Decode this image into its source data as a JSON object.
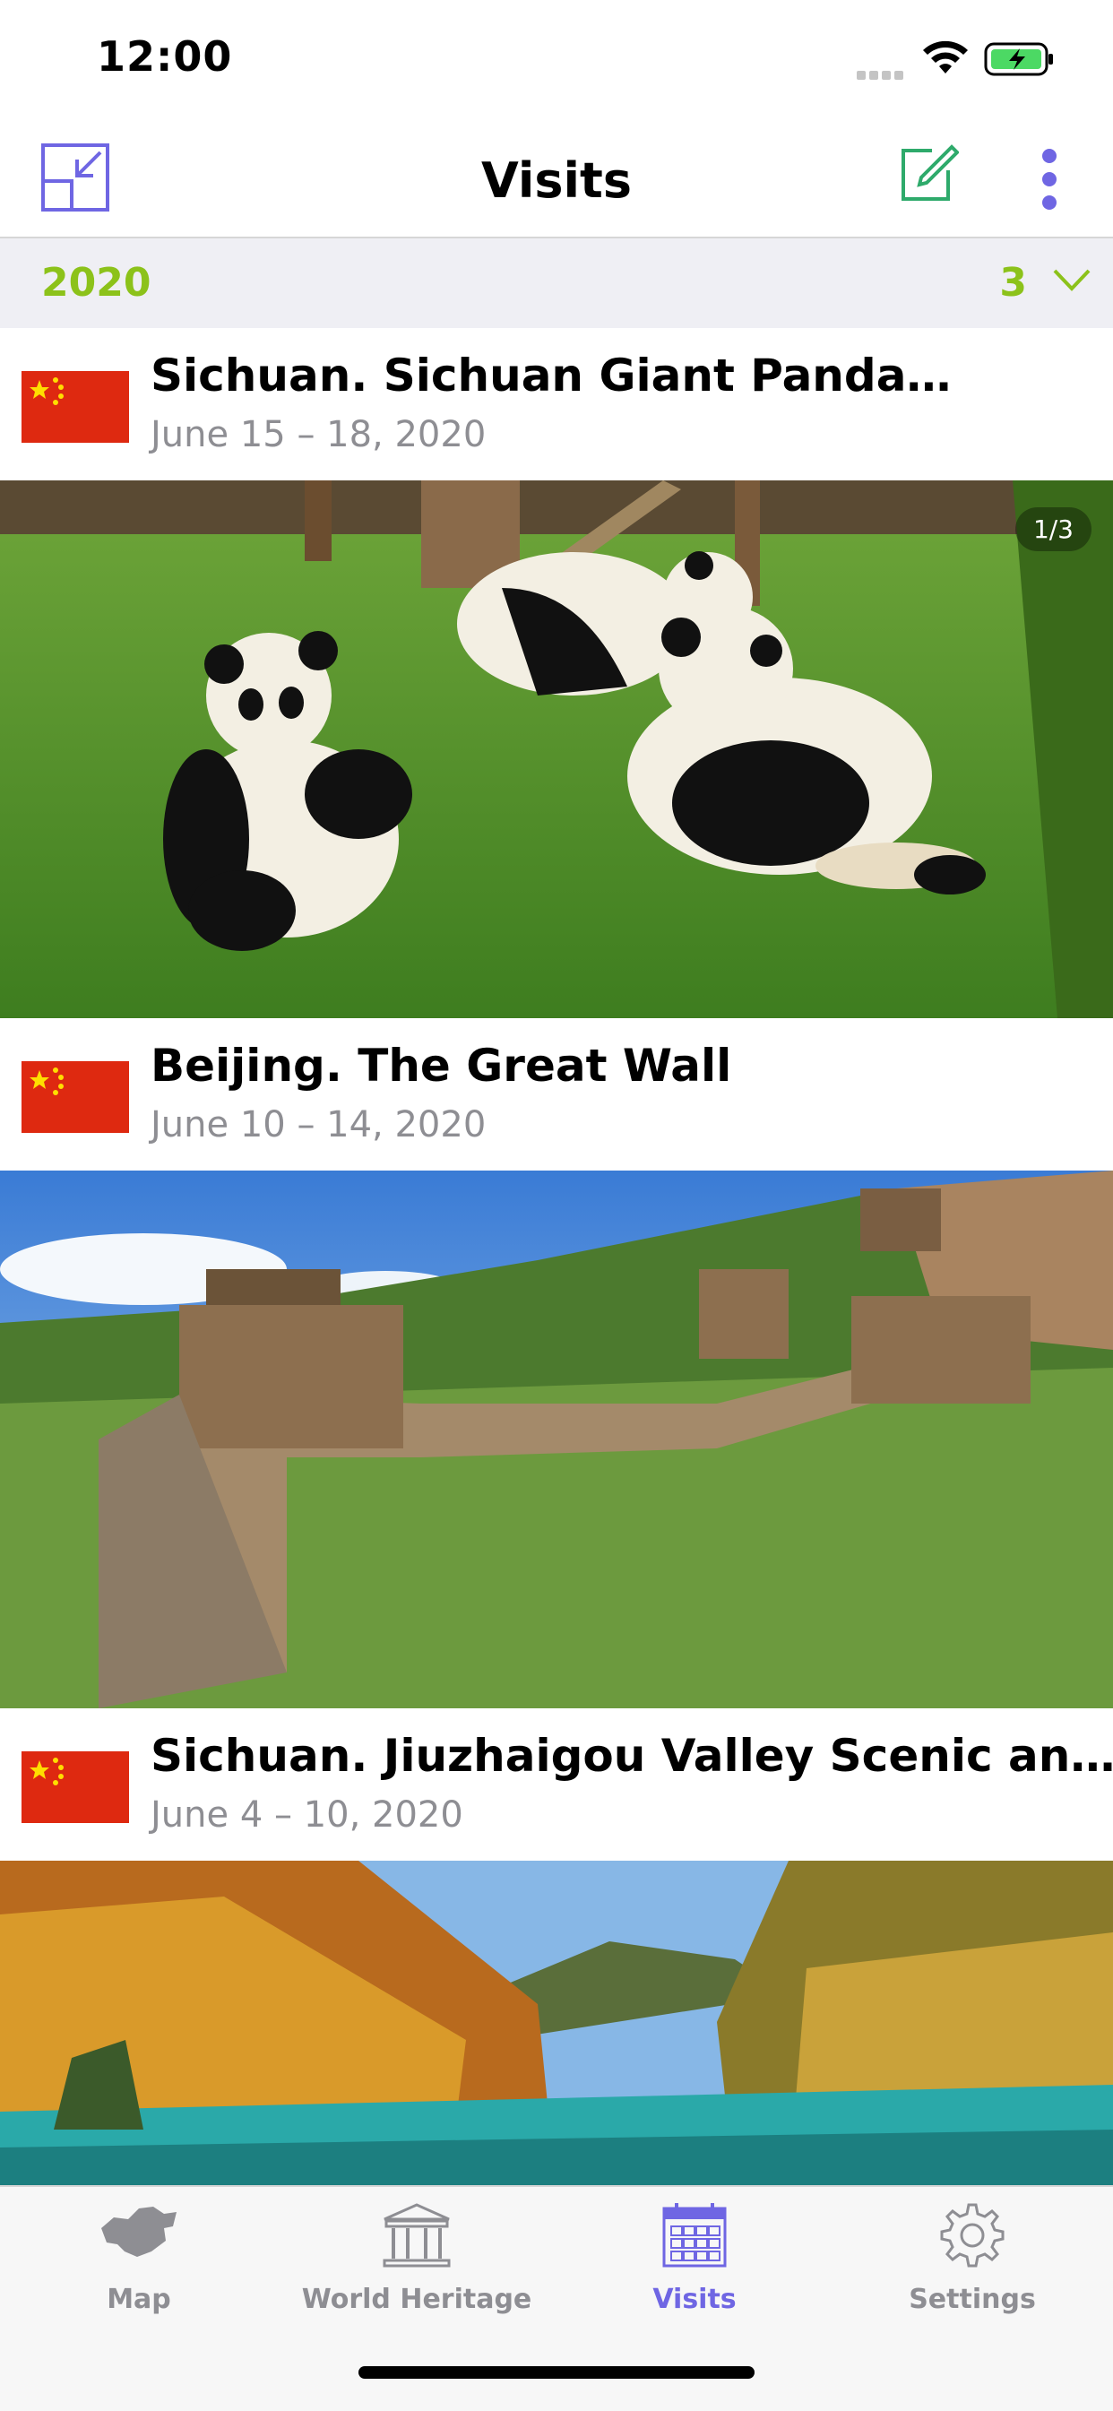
{
  "status_bar": {
    "time": "12:00"
  },
  "nav": {
    "title": "Visits"
  },
  "section": {
    "year": "2020",
    "count": "3"
  },
  "visits": [
    {
      "title": "Sichuan. Sichuan Giant Panda…",
      "dates": "June 15 – 18, 2020",
      "photo_counter": "1/3",
      "country_flag": "china-flag-icon",
      "photo": "giant-pandas"
    },
    {
      "title": "Beijing. The Great Wall",
      "dates": "June 10 – 14, 2020",
      "country_flag": "china-flag-icon",
      "photo": "great-wall"
    },
    {
      "title": "Sichuan. Jiuzhaigou Valley Scenic an…",
      "dates": "June 4 – 10, 2020",
      "country_flag": "china-flag-icon",
      "photo": "jiuzhaigou-valley"
    }
  ],
  "tabs": [
    {
      "label": "Map",
      "icon": "china-map-icon",
      "active": false
    },
    {
      "label": "World Heritage",
      "icon": "temple-icon",
      "active": false
    },
    {
      "label": "Visits",
      "icon": "calendar-icon",
      "active": true
    },
    {
      "label": "Settings",
      "icon": "gear-icon",
      "active": false
    }
  ],
  "colors": {
    "accent": "#6f66e3",
    "section_text": "#8cc21a",
    "compose_green": "#2eaa6b",
    "secondary_text": "#8e8e93",
    "flag_red": "#de2910",
    "flag_star": "#ffde00"
  }
}
